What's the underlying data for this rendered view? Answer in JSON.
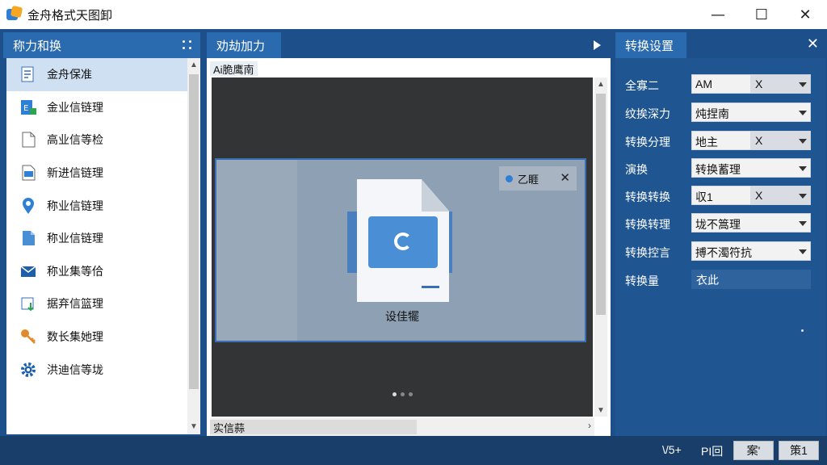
{
  "window": {
    "title": "金舟格式天图卸",
    "controls": {
      "minimize": "—",
      "maximize": "☐",
      "close": "✕"
    }
  },
  "left_panel": {
    "title": "称力和换",
    "items": [
      {
        "label": "金舟保准",
        "icon": "format-icon",
        "selected": true
      },
      {
        "label": "金业信链理",
        "icon": "excel-icon"
      },
      {
        "label": "高业信等检",
        "icon": "document-icon"
      },
      {
        "label": "新进信链理",
        "icon": "slides-icon"
      },
      {
        "label": "称业信链理",
        "icon": "location-pin-icon"
      },
      {
        "label": "称业信链理",
        "icon": "file-icon"
      },
      {
        "label": "称业集等佮",
        "icon": "mail-icon"
      },
      {
        "label": "据弃信篮理",
        "icon": "download-icon"
      },
      {
        "label": "数长集她理",
        "icon": "key-icon"
      },
      {
        "label": "洪迪信等垅",
        "icon": "gear-icon"
      }
    ]
  },
  "center_panel": {
    "tab": "劝劫加力",
    "label": "Ai脆鹰南",
    "preview": {
      "chip_text": "乙睚",
      "caption": "设佳犤"
    },
    "bottom_label": "实信蒜"
  },
  "right_panel": {
    "tab": "转换设置",
    "rows": [
      {
        "label": "全寡二",
        "value": "AM",
        "extra": "X",
        "type": "split"
      },
      {
        "label": "纹挨深力",
        "value": "炖捏南",
        "type": "combo"
      },
      {
        "label": "转换分理",
        "value": "地主",
        "extra": "X",
        "type": "split"
      },
      {
        "label": "演换",
        "value": "转换蓄理",
        "type": "combo"
      },
      {
        "label": "转换转换",
        "value": "収1",
        "extra": "X",
        "type": "split"
      },
      {
        "label": "转换转理",
        "value": "垅不篙理",
        "type": "combo"
      },
      {
        "label": "转换控言",
        "value": "搏不濁符抗",
        "type": "combo"
      },
      {
        "label": "转换量",
        "value": "衣此",
        "type": "readonly"
      }
    ]
  },
  "statusbar": {
    "page": "\\/5+",
    "mode": "PI回",
    "btn1": "案'",
    "btn2": "策1"
  },
  "colors": {
    "accent": "#2a6bb0",
    "panel_bg": "#1d4f8a",
    "selected": "#cfe0f3"
  }
}
